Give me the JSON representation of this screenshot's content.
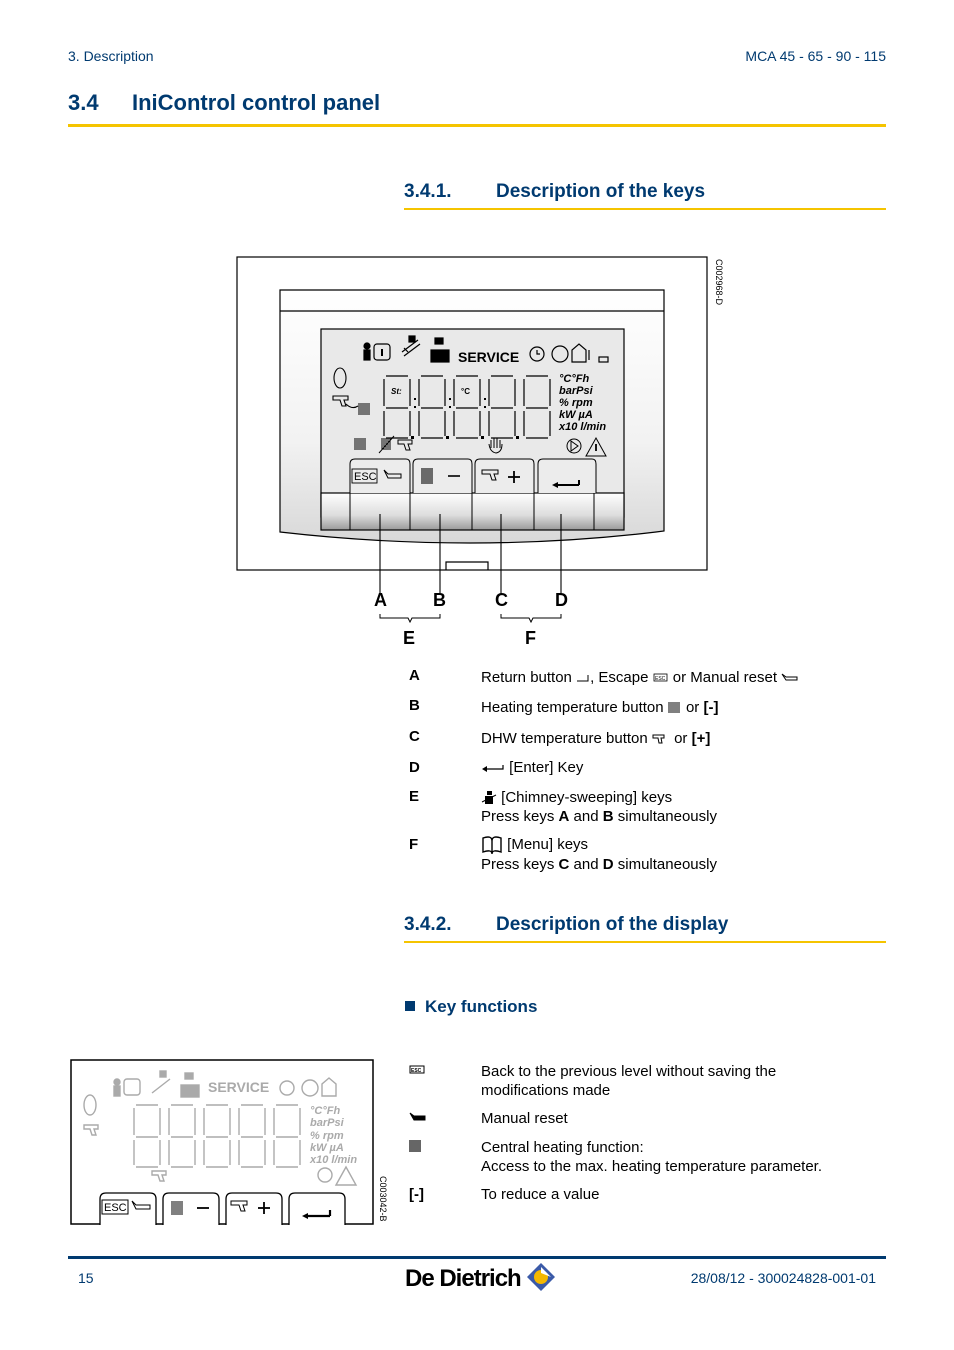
{
  "header": {
    "section": "3.  Description",
    "model": "MCA 45 - 65 - 90 - 115"
  },
  "title": {
    "number": "3.4",
    "text": "IniControl control panel"
  },
  "section_keys": {
    "number": "3.4.1.",
    "title": "Description of the keys",
    "figure_code": "C002968-D",
    "callouts": [
      "A",
      "B",
      "C",
      "D"
    ],
    "groups": [
      "E",
      "F"
    ],
    "items": [
      {
        "letter": "A",
        "line1": "Return button ←┐, Escape [ESC] or Manual reset",
        "text_a": "Return button",
        "text_b": ", Escape",
        "text_c": "or Manual reset"
      },
      {
        "letter": "B",
        "text_a": "Heating temperature button",
        "text_b": "or",
        "bold": "[-]"
      },
      {
        "letter": "C",
        "text_a": "DHW temperature button",
        "text_b": "or",
        "bold": "[+]"
      },
      {
        "letter": "D",
        "text_a": "[Enter] Key"
      },
      {
        "letter": "E",
        "text_a": "[Chimney-sweeping] keys",
        "line2_a": "Press keys",
        "line2_k1": "A",
        "line2_and": "and",
        "line2_k2": "B",
        "line2_b": "simultaneously"
      },
      {
        "letter": "F",
        "text_a": "[Menu] keys",
        "line2_a": "Press keys",
        "line2_k1": "C",
        "line2_and": "and",
        "line2_k2": "D",
        "line2_b": "simultaneously"
      }
    ]
  },
  "section_display": {
    "number": "3.4.2.",
    "title": "Description of the display",
    "subheading": "Key functions",
    "figure_code": "C003042-B",
    "functions": [
      {
        "symbol": "esc-icon",
        "line1": "Back to the previous level without saving the",
        "line2": "modifications made"
      },
      {
        "symbol": "manual-reset-icon",
        "line1": "Manual reset"
      },
      {
        "symbol": "radiator-icon",
        "line1": "Central heating function:",
        "line2": "Access to the max. heating temperature parameter."
      },
      {
        "symbol_text": "[-]",
        "line1": "To reduce a value"
      }
    ]
  },
  "lcd": {
    "service": "SERVICE",
    "st": "St:",
    "degc": "°C",
    "units": [
      "°C°Fh",
      "barPsi",
      "% rpm",
      "kW µA",
      "x10 l/min"
    ],
    "esc": "ESC",
    "minus": "−",
    "plus": "+"
  },
  "footer": {
    "page": "15",
    "brand": "De Dietrich",
    "doc": "28/08/12  - 300024828-001-01"
  },
  "colors": {
    "heading_blue": "#003a70",
    "accent_yellow": "#f5c400"
  }
}
